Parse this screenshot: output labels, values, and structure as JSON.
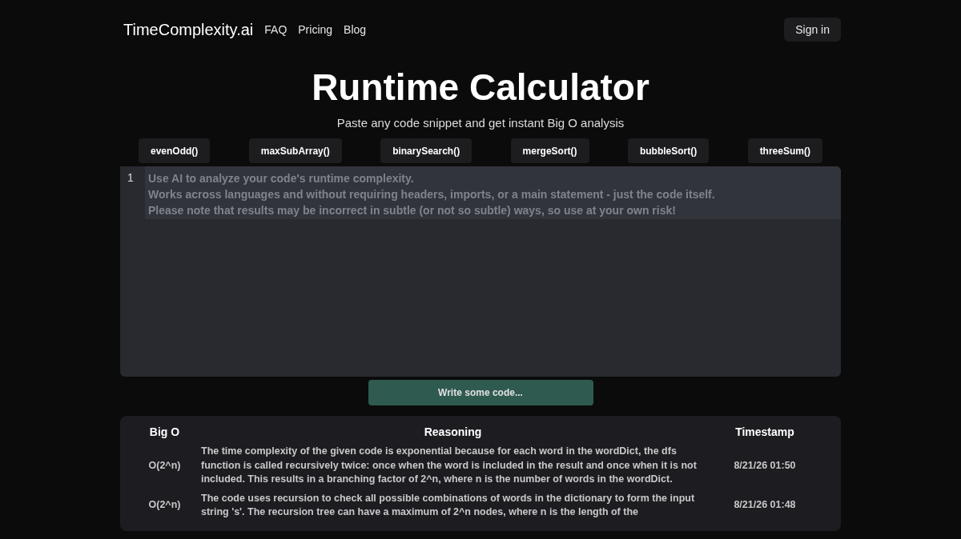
{
  "nav": {
    "brand": "TimeComplexity.ai",
    "links": [
      "FAQ",
      "Pricing",
      "Blog"
    ],
    "sign_in": "Sign in"
  },
  "hero": {
    "title": "Runtime Calculator",
    "subtitle": "Paste any code snippet and get instant Big O analysis"
  },
  "examples": [
    "evenOdd()",
    "maxSubArray()",
    "binarySearch()",
    "mergeSort()",
    "bubbleSort()",
    "threeSum()"
  ],
  "editor": {
    "line_number": "1",
    "placeholder": [
      "Use AI to analyze your code's runtime complexity.",
      "Works across languages and without requiring headers, imports, or a main statement - just the code itself.",
      "Please note that results may be incorrect in subtle (or not so subtle) ways, so use at your own risk!"
    ]
  },
  "submit": {
    "label": "Write some code...",
    "disabled": true
  },
  "table": {
    "columns": [
      "Big O",
      "Reasoning",
      "Timestamp"
    ],
    "rows": [
      {
        "big_o": "O(2^n)",
        "reasoning": "The time complexity of the given code is exponential because for each word in the wordDict, the dfs function is called recursively twice: once when the word is included in the result and once when it is not included. This results in a branching factor of 2^n, where n is the number of words in the wordDict.",
        "timestamp": "8/21/26 01:50"
      },
      {
        "big_o": "O(2^n)",
        "reasoning": "The code uses recursion to check all possible combinations of words in the dictionary to form the input string 's'. The recursion tree can have a maximum of 2^n nodes, where n is the length of the",
        "timestamp": "8/21/26 01:48"
      }
    ]
  }
}
